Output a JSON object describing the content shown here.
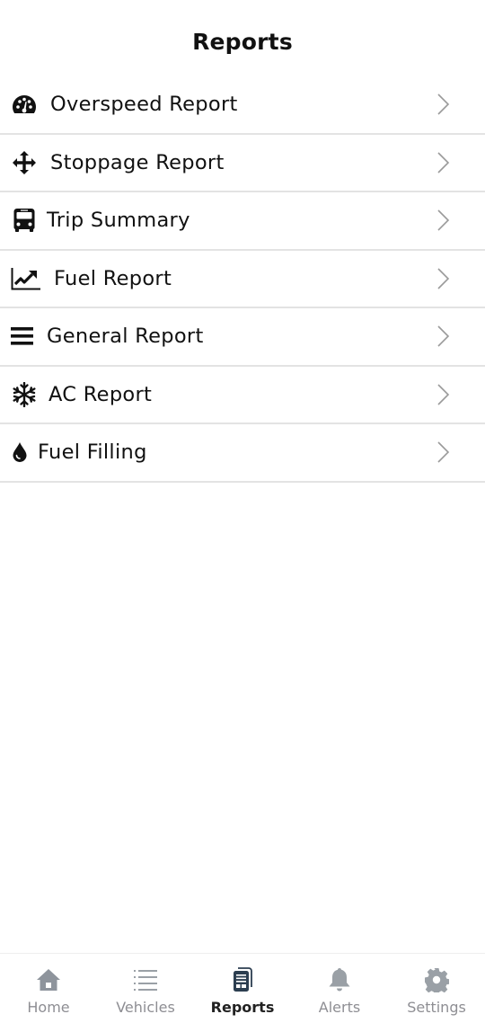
{
  "header": {
    "title": "Reports"
  },
  "reports": [
    {
      "label": "Overspeed Report",
      "icon": "speedometer-icon"
    },
    {
      "label": "Stoppage Report",
      "icon": "move-arrows-icon"
    },
    {
      "label": "Trip Summary",
      "icon": "bus-icon"
    },
    {
      "label": "Fuel Report",
      "icon": "line-chart-icon"
    },
    {
      "label": "General Report",
      "icon": "menu-lines-icon"
    },
    {
      "label": "AC Report",
      "icon": "snowflake-icon"
    },
    {
      "label": "Fuel Filling",
      "icon": "drop-icon"
    }
  ],
  "tabbar": {
    "active": "Reports",
    "colors": {
      "active": "#2c3e50",
      "inactive": "#8e8e93"
    },
    "tabs": [
      {
        "label": "Home",
        "icon": "home-icon"
      },
      {
        "label": "Vehicles",
        "icon": "list-icon"
      },
      {
        "label": "Reports",
        "icon": "reports-icon"
      },
      {
        "label": "Alerts",
        "icon": "bell-icon"
      },
      {
        "label": "Settings",
        "icon": "gear-icon"
      }
    ]
  }
}
